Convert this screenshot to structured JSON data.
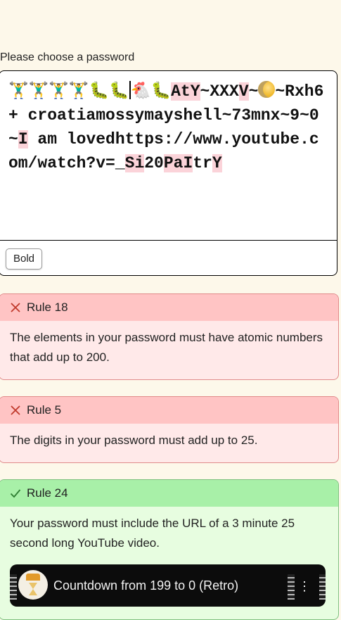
{
  "password_label": "Please choose a password",
  "password": {
    "segments": [
      {
        "text": "🏋️‍♂️🏋️‍♂️🏋️‍♂️🏋️‍♂️🐛🐛",
        "hl": false
      },
      {
        "caret": true
      },
      {
        "text": "🐔🐛",
        "hl": false
      },
      {
        "text": "AtY",
        "hl": true
      },
      {
        "text": "~XXX",
        "hl": false
      },
      {
        "text": "V",
        "hl": true
      },
      {
        "text": "~",
        "hl": false
      },
      {
        "moon": true
      },
      {
        "text": "~Rxh6+ croatiamossymayshell~73mnx~9~0~",
        "hl": false
      },
      {
        "text": "I",
        "hl": true
      },
      {
        "text": " am lovedhttps://www.youtube.com/watch?v=_",
        "hl": false
      },
      {
        "text": "Si",
        "hl": true
      },
      {
        "text": "20",
        "hl": false
      },
      {
        "text": "PaI",
        "hl": true
      },
      {
        "text": "tr",
        "hl": false
      },
      {
        "text": "Y",
        "hl": true
      }
    ]
  },
  "toolbar": {
    "bold_label": "Bold"
  },
  "rules": [
    {
      "id": "rule-18",
      "status": "fail",
      "title": "Rule 18",
      "text": "The elements in your password must have atomic numbers that add up to 200."
    },
    {
      "id": "rule-5",
      "status": "fail",
      "title": "Rule 5",
      "text": "The digits in your password must add up to 25."
    },
    {
      "id": "rule-24",
      "status": "pass",
      "title": "Rule 24",
      "text": "Your password must include the URL of a 3 minute 25 second long YouTube video."
    }
  ],
  "video": {
    "title": "Countdown from 199 to 0 (Retro)",
    "menu_icon": "more-vert-icon"
  },
  "colors": {
    "fail_bg": "#ffe9e9",
    "fail_head": "#ffc4c4",
    "pass_bg": "#e7fde0",
    "pass_head": "#a8f0a8",
    "highlight": "#fbd3d9"
  }
}
